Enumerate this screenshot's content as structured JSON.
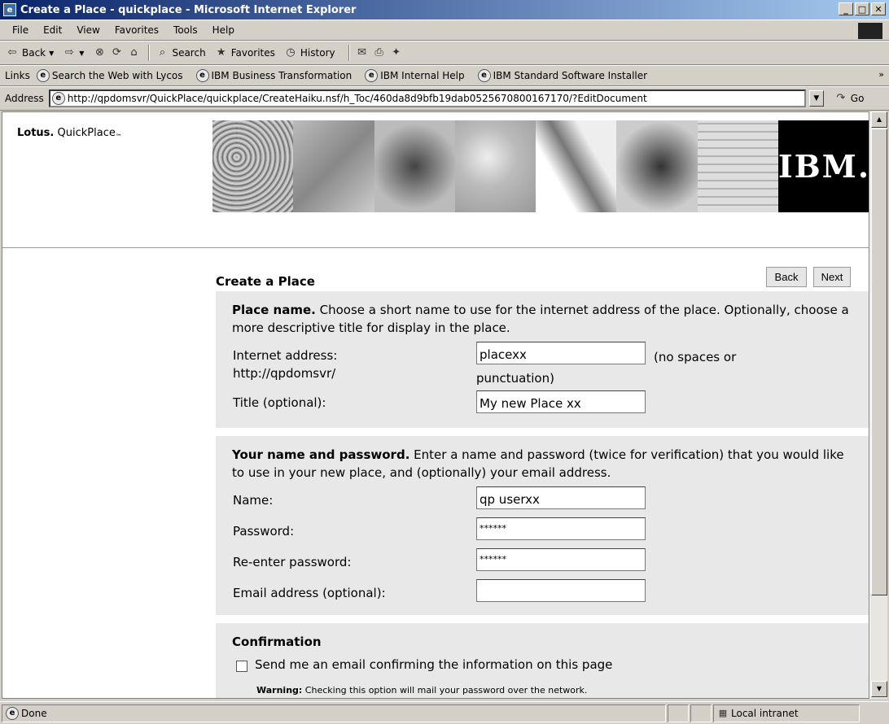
{
  "window": {
    "title": "Create a Place - quickplace - Microsoft Internet Explorer"
  },
  "menu": [
    "File",
    "Edit",
    "View",
    "Favorites",
    "Tools",
    "Help"
  ],
  "toolbar": {
    "back": "Back",
    "search": "Search",
    "favorites": "Favorites",
    "history": "History"
  },
  "links": {
    "label": "Links",
    "items": [
      "Search the Web with Lycos",
      "IBM Business Transformation",
      "IBM Internal Help",
      "IBM Standard Software Installer"
    ]
  },
  "address": {
    "label": "Address",
    "url": "http://qpdomsvr/QuickPlace/quickplace/CreateHaiku.nsf/h_Toc/460da8d9bfb19dab0525670800167170/?EditDocument",
    "go": "Go"
  },
  "header": {
    "lotus": "Lotus.",
    "product": "QuickPlace",
    "tm": "™",
    "ibm": "IBM."
  },
  "page": {
    "title": "Create a Place",
    "back_button": "Back",
    "next_button": "Next"
  },
  "place_name": {
    "heading": "Place name.",
    "description": " Choose a short name to use for the internet address of the place. Optionally, choose a more descriptive title for display in the place.",
    "internet_address_label": "Internet address:",
    "internet_address_prefix": "http://qpdomsvr/",
    "internet_address_value": "placexx",
    "internet_address_note_1": "(no spaces or",
    "internet_address_note_2": "punctuation)",
    "title_label": "Title (optional):",
    "title_value": "My new Place xx"
  },
  "credentials": {
    "heading": "Your name and password.",
    "description": " Enter a name and password (twice for verification) that you would like to use in your new place, and (optionally) your email address.",
    "name_label": "Name:",
    "name_value": "qp userxx",
    "password_label": "Password:",
    "password_value": "******",
    "reenter_label": "Re-enter password:",
    "reenter_value": "******",
    "email_label": "Email address (optional):",
    "email_value": ""
  },
  "confirmation": {
    "heading": "Confirmation",
    "checkbox_label": "Send me an email confirming the information on this page",
    "checked": false,
    "warning_label": "Warning:",
    "warning_text": " Checking this option will mail your password over the network."
  },
  "status": {
    "text": "Done",
    "zone": "Local intranet"
  }
}
